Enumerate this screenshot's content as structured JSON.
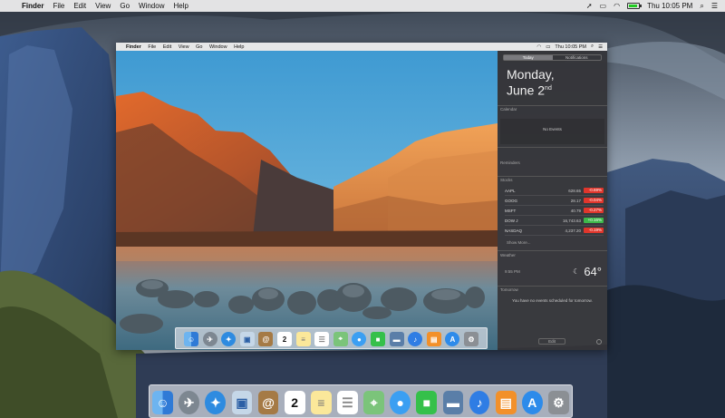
{
  "menubar": {
    "apple_symbol": "",
    "items": [
      "Finder",
      "File",
      "Edit",
      "View",
      "Go",
      "Window",
      "Help"
    ],
    "datetime": "Thu 10:05 PM"
  },
  "inner_menubar": {
    "apple_symbol": "",
    "items": [
      "Finder",
      "File",
      "Edit",
      "View",
      "Go",
      "Window",
      "Help"
    ],
    "datetime": "Thu 10:05 PM"
  },
  "notification_center": {
    "tabs": [
      "Today",
      "Notifications"
    ],
    "active_tab": "Today",
    "date_line1": "Monday,",
    "date_line2": "June 2",
    "date_suffix": "nd",
    "calendar": {
      "title": "Calendar",
      "empty_text": "No Events"
    },
    "reminders": {
      "title": "Reminders"
    },
    "stocks": {
      "title": "Stocks",
      "rows": [
        {
          "symbol": "AAPL",
          "price": "628.65",
          "change": "-0.69%",
          "direction": "neg"
        },
        {
          "symbol": "GOOG",
          "price": "28.17",
          "change": "-0.04%",
          "direction": "neg"
        },
        {
          "symbol": "MSFT",
          "price": "40.79",
          "change": "-0.27%",
          "direction": "neg"
        },
        {
          "symbol": "DOW J",
          "price": "16,743.63",
          "change": "+0.16%",
          "direction": "pos"
        },
        {
          "symbol": "NASDAQ",
          "price": "4,237.20",
          "change": "-0.19%",
          "direction": "neg"
        }
      ],
      "show_more": "Show More..."
    },
    "weather": {
      "title": "Weather",
      "location": "9:55 PM",
      "temperature": "64°"
    },
    "tomorrow": {
      "title": "Tomorrow",
      "text": "You have no events scheduled for tomorrow."
    },
    "edit_button": "Edit"
  },
  "calendar_icon_day": "2",
  "colors": {
    "nc_background": "#343438",
    "stock_negative": "#e0362c",
    "stock_positive": "#3db84a",
    "sky": "#5aa9d8"
  },
  "dock_icons": [
    "finder-icon",
    "launchpad-icon",
    "safari-icon",
    "photo-icon",
    "contacts-icon",
    "calendar-icon",
    "notes-icon",
    "reminders-icon",
    "maps-icon",
    "messages-icon",
    "facetime-icon",
    "iphoto-icon",
    "itunes-icon",
    "ibooks-icon",
    "app-store-icon",
    "system-preferences-icon"
  ]
}
